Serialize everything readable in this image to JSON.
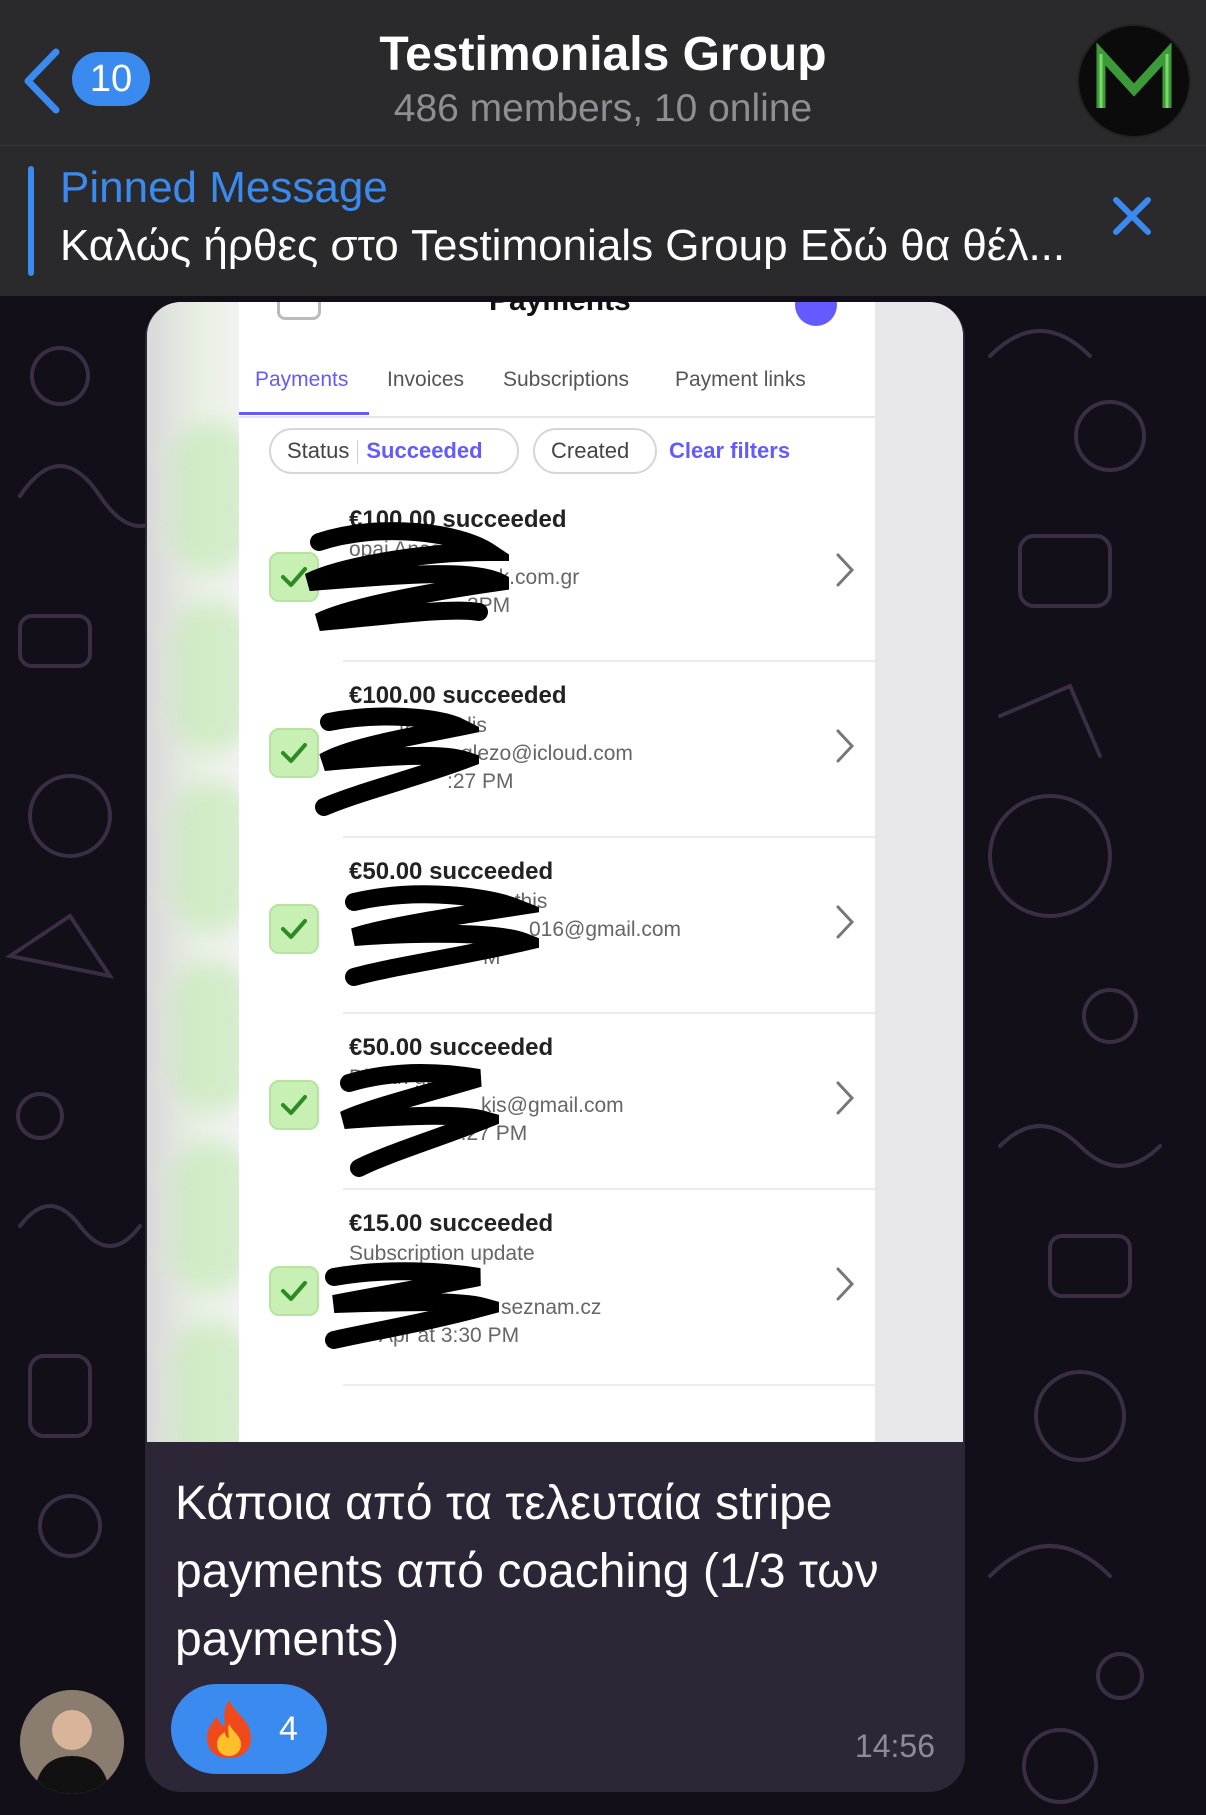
{
  "header": {
    "back_label": "",
    "unread_count": "10",
    "title": "Testimonials Group",
    "subtitle": "486 members, 10 online",
    "avatar_letter": "M"
  },
  "pinned": {
    "title": "Pinned Message",
    "text": "Καλώς ήρθες στο Testimonials Group Εδώ θα θέλ..."
  },
  "screenshot": {
    "title": "Payments",
    "tabs": [
      {
        "label": "Payments",
        "active": true
      },
      {
        "label": "Invoices",
        "active": false
      },
      {
        "label": "Subscriptions",
        "active": false
      },
      {
        "label": "Payment links",
        "active": false
      }
    ],
    "filters": {
      "status_label": "Status",
      "status_value": "Succeeded",
      "created_label": "Created",
      "clear_label": "Clear filters"
    },
    "payments": [
      {
        "amount": "€100.00 succeeded",
        "line1": "opai Anastasis",
        "line2": "ok.com.gr",
        "line3": "3PM"
      },
      {
        "amount": "€100.00 succeeded",
        "line1": "tasia T lis",
        "line2": "glezo@icloud.com",
        "line3": ":27 PM"
      },
      {
        "amount": "€50.00 succeeded",
        "line1": "ostathis",
        "line2": "016@gmail.com",
        "line3": "M"
      },
      {
        "amount": "€50.00 succeeded",
        "line1": "Dimitri gas",
        "line2": "kis@gmail.com",
        "line3": "7:27 PM"
      },
      {
        "amount": "€15.00 succeeded",
        "line1": "Subscription update",
        "line2": "seznam.cz",
        "line3": "Apr at 3:30 PM"
      }
    ]
  },
  "message": {
    "caption": "Κάποια από τα τελευταία stripe payments από coaching (1/3 των payments)",
    "reaction_emoji": "🔥",
    "reaction_count": "4",
    "time": "14:56"
  },
  "colors": {
    "accent": "#3b8af0",
    "stripe": "#635bff",
    "bubble": "#2c2637",
    "header": "#2a2a2c"
  }
}
